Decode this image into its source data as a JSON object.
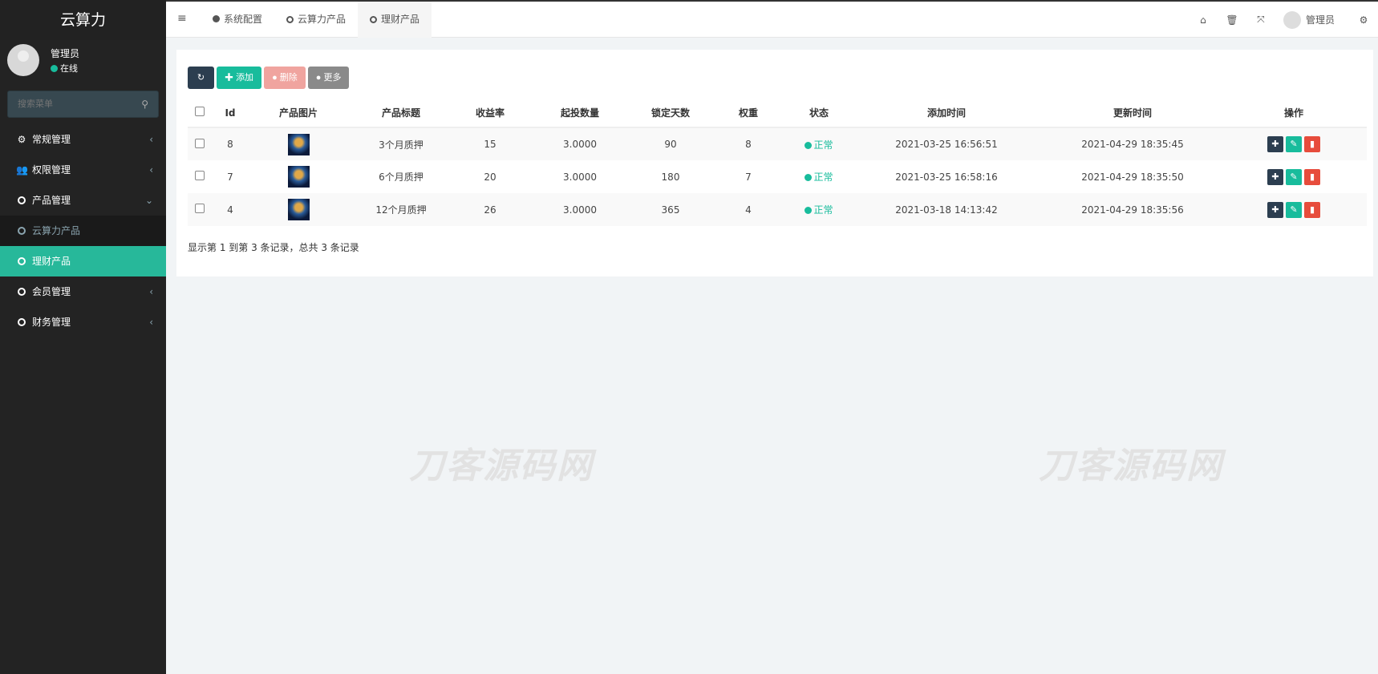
{
  "app": {
    "title": "云算力"
  },
  "user": {
    "name": "管理员",
    "status": "在线"
  },
  "search": {
    "placeholder": "搜索菜单"
  },
  "menu": [
    {
      "label": "常规管理",
      "icon": "cogs-icon",
      "chev": "‹"
    },
    {
      "label": "权限管理",
      "icon": "group-icon",
      "chev": "‹"
    },
    {
      "label": "产品管理",
      "icon": "circle-icon",
      "chev": "⌄"
    },
    {
      "label": "云算力产品",
      "icon": "circle-icon"
    },
    {
      "label": "理财产品",
      "icon": "circle-icon"
    },
    {
      "label": "会员管理",
      "icon": "circle-icon",
      "chev": "‹"
    },
    {
      "label": "财务管理",
      "icon": "circle-icon",
      "chev": "‹"
    }
  ],
  "tabs": [
    {
      "label": "系统配置"
    },
    {
      "label": "云算力产品"
    },
    {
      "label": "理财产品"
    }
  ],
  "topbar": {
    "username": "管理员"
  },
  "toolbar": {
    "add": "添加",
    "delete": "删除",
    "more": "更多"
  },
  "table": {
    "headers": [
      "Id",
      "产品图片",
      "产品标题",
      "收益率",
      "起投数量",
      "锁定天数",
      "权重",
      "状态",
      "添加时间",
      "更新时间",
      "操作"
    ],
    "rows": [
      {
        "id": "8",
        "title": "3个月质押",
        "rate": "15",
        "min": "3.0000",
        "days": "90",
        "weight": "8",
        "status": "正常",
        "created": "2021-03-25 16:56:51",
        "updated": "2021-04-29 18:35:45"
      },
      {
        "id": "7",
        "title": "6个月质押",
        "rate": "20",
        "min": "3.0000",
        "days": "180",
        "weight": "7",
        "status": "正常",
        "created": "2021-03-25 16:58:16",
        "updated": "2021-04-29 18:35:50"
      },
      {
        "id": "4",
        "title": "12个月质押",
        "rate": "26",
        "min": "3.0000",
        "days": "365",
        "weight": "4",
        "status": "正常",
        "created": "2021-03-18 14:13:42",
        "updated": "2021-04-29 18:35:56"
      }
    ]
  },
  "pagination": {
    "info": "显示第 1 到第 3 条记录，总共 3 条记录"
  },
  "watermark": "刀客源码网",
  "colors": {
    "accent": "#18bc9c",
    "dark": "#2c3e50",
    "danger": "#e74c3c"
  }
}
